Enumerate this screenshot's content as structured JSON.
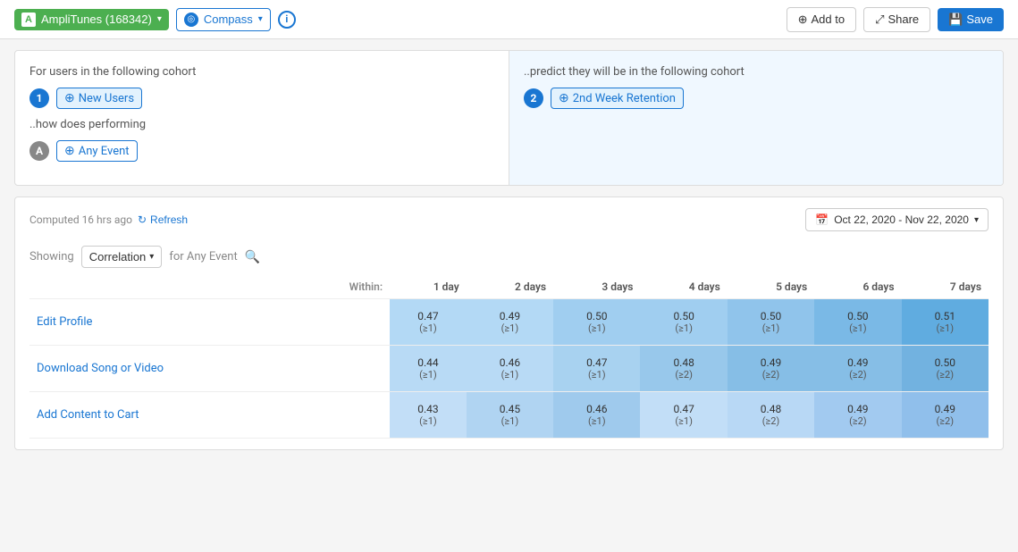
{
  "topbar": {
    "app_name": "AmpliTunes (168342)",
    "app_letter": "A",
    "compass_label": "Compass",
    "info_label": "i",
    "add_label": "Add to",
    "share_label": "Share",
    "save_label": "Save"
  },
  "cohort_panel": {
    "left": {
      "title": "For users in the following cohort",
      "badge_number": "1",
      "cohort_tag": "New Users",
      "how_does_label": "..how does performing",
      "event_badge": "A",
      "event_tag": "Any Event"
    },
    "right": {
      "title": "..predict they will be in the following cohort",
      "badge_number": "2",
      "cohort_tag": "2nd Week Retention"
    }
  },
  "results_panel": {
    "computed_text": "Computed 16 hrs ago",
    "refresh_label": "Refresh",
    "date_range": "Oct 22, 2020 - Nov 22, 2020",
    "showing_label": "Showing",
    "correlation_label": "Correlation",
    "for_label": "for Any Event",
    "within_label": "Within:",
    "columns": [
      "1 day",
      "2 days",
      "3 days",
      "4 days",
      "5 days",
      "6 days",
      "7 days"
    ],
    "rows": [
      {
        "event": "Edit Profile",
        "values": [
          {
            "top": "0.47",
            "sub": "(≥1)"
          },
          {
            "top": "0.49",
            "sub": "(≥1)"
          },
          {
            "top": "0.50",
            "sub": "(≥1)"
          },
          {
            "top": "0.50",
            "sub": "(≥1)"
          },
          {
            "top": "0.50",
            "sub": "(≥1)"
          },
          {
            "top": "0.50",
            "sub": "(≥1)"
          },
          {
            "top": "0.51",
            "sub": "(≥1)"
          }
        ]
      },
      {
        "event": "Download Song or Video",
        "values": [
          {
            "top": "0.44",
            "sub": "(≥1)"
          },
          {
            "top": "0.46",
            "sub": "(≥1)"
          },
          {
            "top": "0.47",
            "sub": "(≥1)"
          },
          {
            "top": "0.48",
            "sub": "(≥2)"
          },
          {
            "top": "0.49",
            "sub": "(≥2)"
          },
          {
            "top": "0.49",
            "sub": "(≥2)"
          },
          {
            "top": "0.50",
            "sub": "(≥2)"
          }
        ]
      },
      {
        "event": "Add Content to Cart",
        "values": [
          {
            "top": "0.43",
            "sub": "(≥1)"
          },
          {
            "top": "0.45",
            "sub": "(≥1)"
          },
          {
            "top": "0.46",
            "sub": "(≥1)"
          },
          {
            "top": "0.47",
            "sub": "(≥1)"
          },
          {
            "top": "0.48",
            "sub": "(≥2)"
          },
          {
            "top": "0.49",
            "sub": "(≥2)"
          },
          {
            "top": "0.49",
            "sub": "(≥2)"
          }
        ]
      }
    ]
  }
}
